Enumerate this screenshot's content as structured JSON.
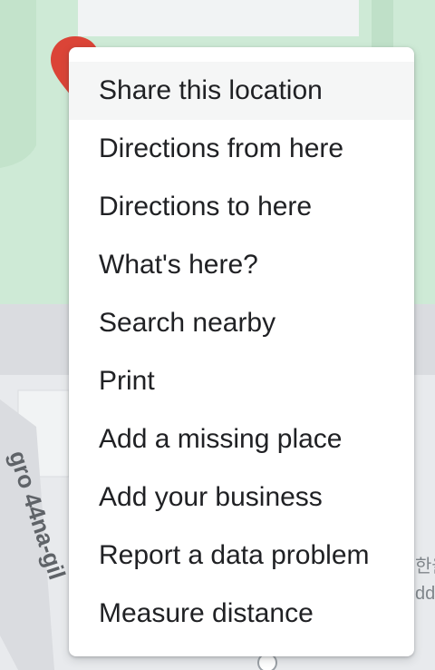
{
  "map": {
    "street_label": "gro 44na-gil",
    "side_label_line1": "한울",
    "side_label_line2": "ddle",
    "pin_color": "#db4437",
    "park_color": "#ceead6",
    "road_color": "#dadce0",
    "building_color": "#f1f3f4"
  },
  "context_menu": {
    "items": [
      {
        "label": "Share this location",
        "highlighted": true
      },
      {
        "label": "Directions from here"
      },
      {
        "label": "Directions to here"
      },
      {
        "label": "What's here?"
      },
      {
        "label": "Search nearby"
      },
      {
        "label": "Print"
      },
      {
        "label": "Add a missing place"
      },
      {
        "label": "Add your business"
      },
      {
        "label": "Report a data problem"
      },
      {
        "label": "Measure distance"
      }
    ]
  }
}
